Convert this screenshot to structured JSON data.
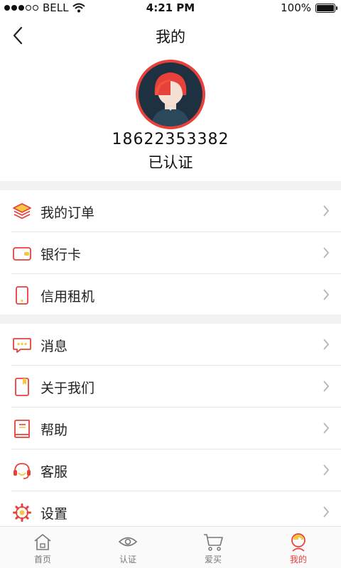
{
  "status_bar": {
    "carrier": "BELL",
    "time": "4:21 PM",
    "battery": "100%"
  },
  "nav": {
    "title": "我的"
  },
  "profile": {
    "phone": "18622353382",
    "status": "已认证"
  },
  "menu_group_1": [
    {
      "label": "我的订单",
      "icon": "orders-layers-icon"
    },
    {
      "label": "银行卡",
      "icon": "bank-card-wallet-icon"
    },
    {
      "label": "信用租机",
      "icon": "phone-rental-icon"
    }
  ],
  "menu_group_2": [
    {
      "label": "消息",
      "icon": "message-bubble-icon"
    },
    {
      "label": "关于我们",
      "icon": "about-book-icon"
    },
    {
      "label": "帮助",
      "icon": "help-book-icon"
    },
    {
      "label": "客服",
      "icon": "headset-icon"
    },
    {
      "label": "设置",
      "icon": "gear-icon"
    }
  ],
  "tabs": [
    {
      "label": "首页",
      "icon": "home-icon"
    },
    {
      "label": "认证",
      "icon": "eye-icon"
    },
    {
      "label": "爱买",
      "icon": "cart-icon"
    },
    {
      "label": "我的",
      "icon": "profile-icon",
      "active": true
    }
  ],
  "colors": {
    "accent": "#e8403a",
    "icon_yellow": "#f5c842",
    "divider": "#e6e6e6"
  }
}
